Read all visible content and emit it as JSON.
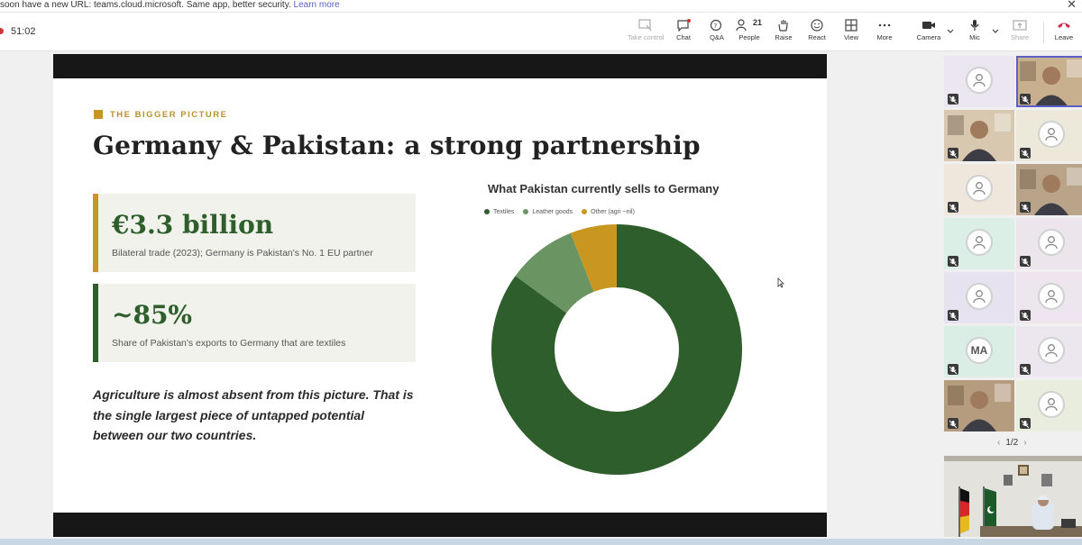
{
  "banner": {
    "text": "soon have a new URL: teams.cloud.microsoft. Same app, better security.",
    "link": "Learn more"
  },
  "toolbar": {
    "timer": "51:02",
    "buttons": [
      {
        "label": "Take control",
        "icon": "take-control-icon",
        "disabled": true
      },
      {
        "label": "Chat",
        "icon": "chat-icon"
      },
      {
        "label": "Q&A",
        "icon": "qa-icon"
      },
      {
        "label": "People",
        "icon": "people-icon",
        "count": "21"
      },
      {
        "label": "Raise",
        "icon": "raise-hand-icon"
      },
      {
        "label": "React",
        "icon": "react-icon"
      },
      {
        "label": "View",
        "icon": "view-icon"
      },
      {
        "label": "More",
        "icon": "more-icon"
      },
      {
        "label": "Camera",
        "icon": "camera-icon"
      },
      {
        "label": "Mic",
        "icon": "mic-icon"
      },
      {
        "label": "Share",
        "icon": "share-icon",
        "disabled": true
      },
      {
        "label": "Leave",
        "icon": "leave-icon"
      }
    ]
  },
  "slide": {
    "eyebrow": "THE BIGGER PICTURE",
    "title": "Germany & Pakistan: a strong partnership",
    "card1": {
      "big": "€3.3 billion",
      "sub": "Bilateral trade (2023); Germany is Pakistan's No. 1 EU partner"
    },
    "card2": {
      "big": "~85%",
      "sub": "Share of Pakistan's exports to Germany that are textiles"
    },
    "paragraph": "Agriculture is almost absent from this picture. That is the single largest piece of untapped potential between our two countries.",
    "colors": {
      "gold": "#c9961f",
      "green": "#2d5e2b",
      "card_bg": "#f1f2eb"
    }
  },
  "chart_data": {
    "type": "pie",
    "title": "What Pakistan currently sells to Germany",
    "donut": true,
    "legend_position": "top",
    "categories": [
      "Textiles",
      "Leather goods",
      "Other (agri ~nil)"
    ],
    "values": [
      85,
      9,
      6
    ],
    "colors": [
      "#2d5e2b",
      "#6a9461",
      "#c9961f"
    ]
  },
  "participants": {
    "tiles": [
      {
        "type": "avatar",
        "initials": "",
        "bg": "#ece6f0"
      },
      {
        "type": "video",
        "bg": "#c8b08f"
      },
      {
        "type": "video",
        "bg": "#d8c8b0"
      },
      {
        "type": "avatar",
        "initials": "",
        "bg": "#ece9da"
      },
      {
        "type": "avatar",
        "initials": "",
        "bg": "#efe6dc"
      },
      {
        "type": "video",
        "bg": "#b9a48a"
      },
      {
        "type": "avatar",
        "initials": "",
        "bg": "#dbefe6"
      },
      {
        "type": "avatar",
        "initials": "",
        "bg": "#ece6ec"
      },
      {
        "type": "avatar",
        "initials": "",
        "bg": "#e7e2ef"
      },
      {
        "type": "avatar",
        "initials": "",
        "bg": "#ede6ef"
      },
      {
        "type": "avatar",
        "initials": "MA",
        "bg": "#dbeee6"
      },
      {
        "type": "avatar",
        "initials": "",
        "bg": "#ece6ef"
      },
      {
        "type": "video",
        "bg": "#b59c7f"
      },
      {
        "type": "avatar",
        "initials": "",
        "bg": "#e8edde"
      }
    ],
    "pager": "1/2"
  }
}
